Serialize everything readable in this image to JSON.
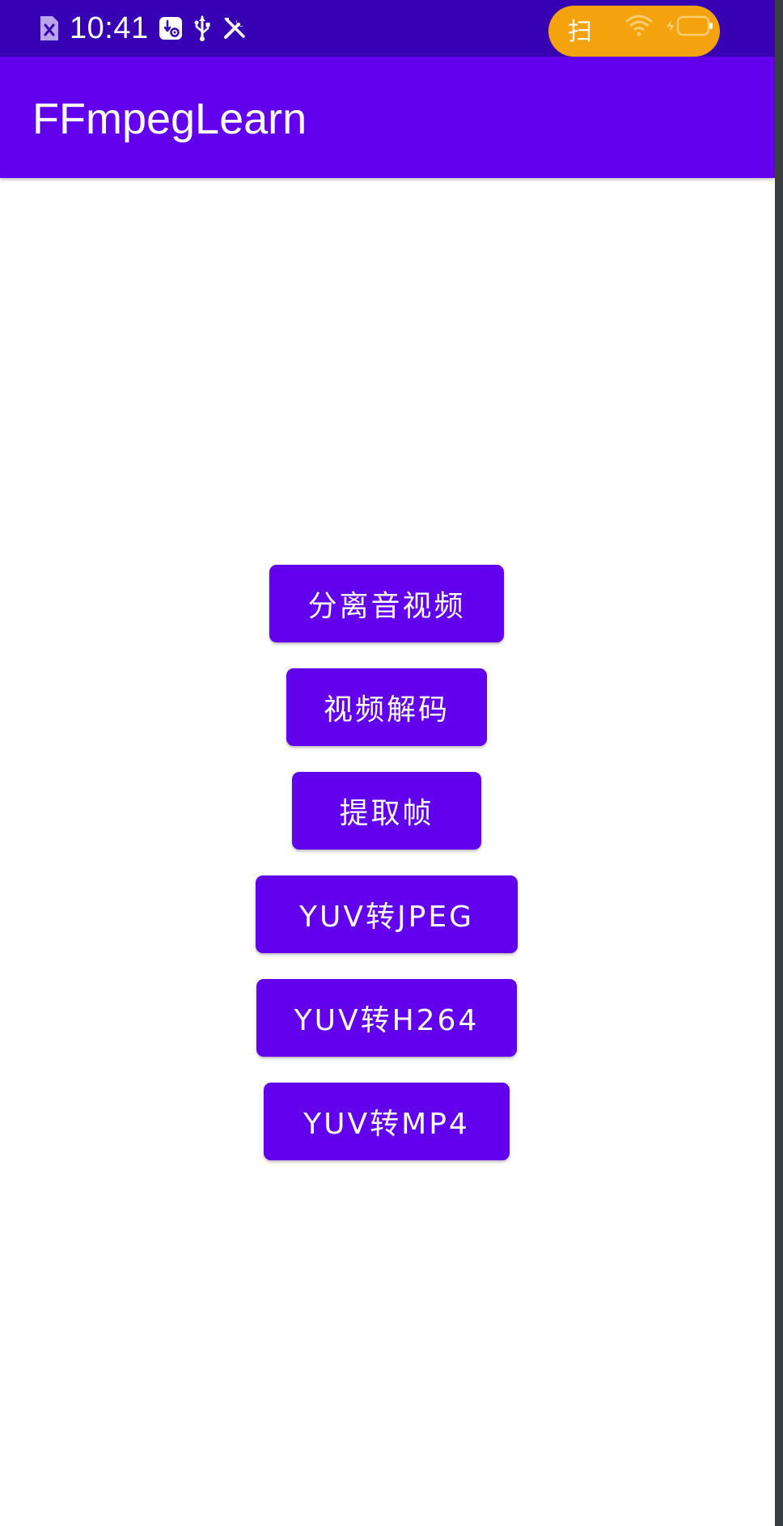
{
  "status_bar": {
    "time": "10:41",
    "pill_text": "扫",
    "icons": [
      "sim-error-icon",
      "usb-debug-icon",
      "usb-icon",
      "tools-icon",
      "wifi-icon",
      "battery-icon"
    ],
    "background": "#3700b3",
    "pill_color": "#f4a30e"
  },
  "app_bar": {
    "title": "FFmpegLearn",
    "background": "#6200ee"
  },
  "buttons": [
    {
      "label": "分离音视频"
    },
    {
      "label": "视频解码"
    },
    {
      "label": "提取帧"
    },
    {
      "label": "YUV转JPEG"
    },
    {
      "label": "YUV转H264"
    },
    {
      "label": "YUV转MP4"
    }
  ],
  "theme": {
    "primary": "#6200ee",
    "primary_dark": "#3700b3",
    "on_primary": "#ffffff",
    "background": "#ffffff"
  }
}
